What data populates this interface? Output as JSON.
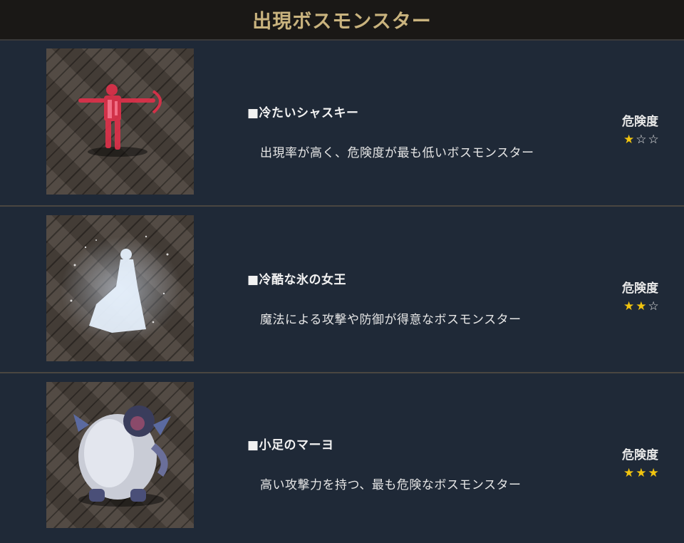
{
  "header": {
    "title": "出現ボスモンスター"
  },
  "risk_label": "危険度",
  "bosses": [
    {
      "name": "■冷たいシャスキー",
      "description": "出現率が高く、危険度が最も低いボスモンスター",
      "danger_rating": 1,
      "danger_max": 3,
      "stars": [
        "★",
        "☆",
        "☆"
      ]
    },
    {
      "name": "■冷酷な氷の女王",
      "description": "魔法による攻撃や防御が得意なボスモンスター",
      "danger_rating": 2,
      "danger_max": 3,
      "stars": [
        "★",
        "★",
        "☆"
      ]
    },
    {
      "name": "■小足のマーヨ",
      "description": "高い攻撃力を持つ、最も危険なボスモンスター",
      "danger_rating": 3,
      "danger_max": 3,
      "stars": [
        "★",
        "★",
        "★"
      ]
    }
  ],
  "colors": {
    "star_on": "#f1c40f",
    "header_text": "#c9b37e",
    "row_background": "#1f2937"
  }
}
